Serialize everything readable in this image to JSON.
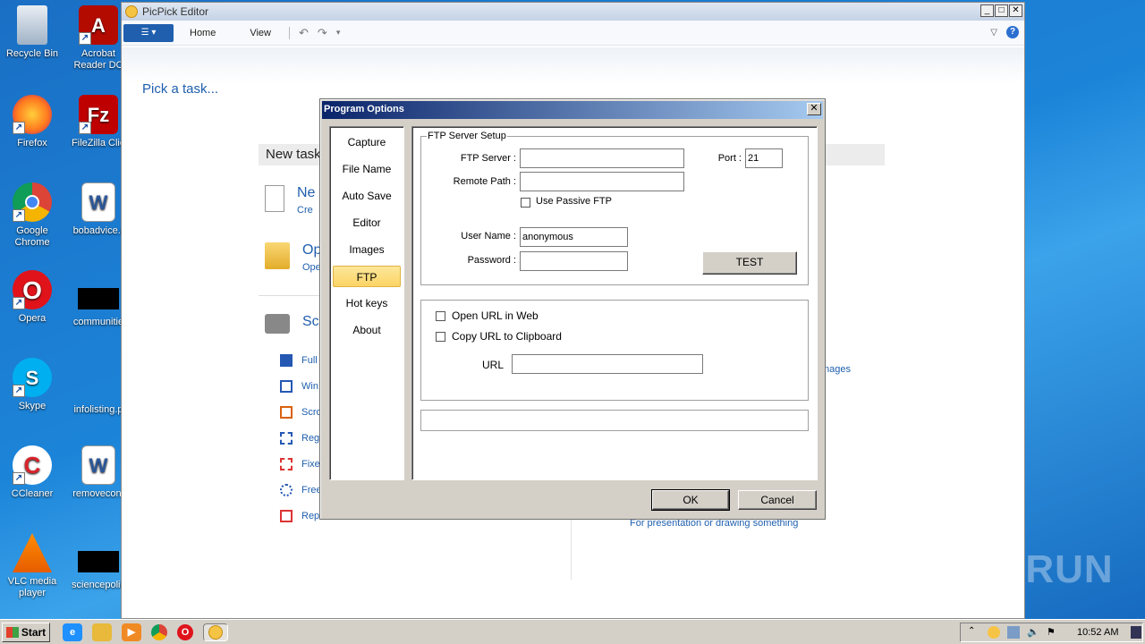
{
  "desktop": {
    "icons": [
      {
        "label": "Recycle Bin"
      },
      {
        "label": "Acrobat Reader DC"
      },
      {
        "label": "Firefox"
      },
      {
        "label": "FileZilla Clie"
      },
      {
        "label": "Google Chrome"
      },
      {
        "label": "bobadvice.r"
      },
      {
        "label": "Opera"
      },
      {
        "label": "communitie"
      },
      {
        "label": "Skype"
      },
      {
        "label": "infolisting.p"
      },
      {
        "label": "CCleaner"
      },
      {
        "label": "removecont"
      },
      {
        "label": "VLC media player"
      },
      {
        "label": "sciencepolic"
      }
    ]
  },
  "app": {
    "title": "PicPick Editor",
    "ribbon": {
      "tab_home": "Home",
      "tab_view": "View"
    },
    "pick_task": "Pick a task...",
    "new_task": "New task",
    "task_new_head": "Ne",
    "task_new_sub": "Cre",
    "task_open_head": "Op",
    "task_open_sub": "Ope",
    "task_screen_head": "Scr",
    "capture_items": [
      "Full",
      "Win",
      "Scro",
      "Reg",
      "Fixe",
      "Free",
      "Rep"
    ],
    "right_link_images": "nages",
    "right_link_presentation": "For presentation or drawing something"
  },
  "dialog": {
    "title": "Program Options",
    "nav": [
      "Capture",
      "File Name",
      "Auto Save",
      "Editor",
      "Images",
      "FTP",
      "Hot keys",
      "About"
    ],
    "selected_nav": "FTP",
    "ftp": {
      "group_title": "FTP Server Setup",
      "server_label": "FTP Server :",
      "server_value": "",
      "port_label": "Port :",
      "port_value": "21",
      "remote_path_label": "Remote Path :",
      "remote_path_value": "",
      "passive_label": "Use Passive FTP",
      "passive_checked": false,
      "username_label": "User Name :",
      "username_value": "anonymous",
      "password_label": "Password :",
      "password_value": "",
      "test_button": "TEST"
    },
    "url": {
      "open_in_web_label": "Open URL in Web",
      "copy_to_clipboard_label": "Copy URL to Clipboard",
      "url_label": "URL",
      "url_value": ""
    },
    "ok_button": "OK",
    "cancel_button": "Cancel"
  },
  "taskbar": {
    "start_label": "Start",
    "clock": "10:52 AM"
  },
  "watermark": "ANY RUN"
}
